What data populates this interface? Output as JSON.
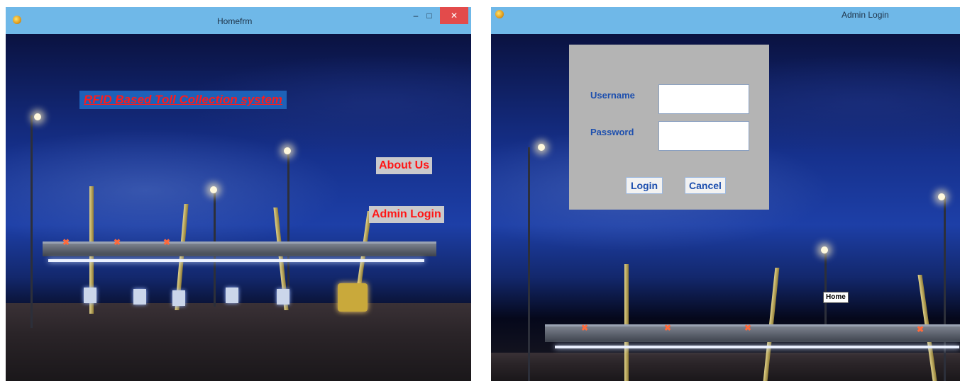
{
  "left_window": {
    "title": "Homefrm",
    "controls": {
      "minimize": "–",
      "maximize": "□",
      "close": "✕"
    },
    "heading_link": "RFID Based Toll Collection system",
    "about_us": "About Us",
    "admin_login": "Admin Login"
  },
  "right_window": {
    "title": "Admin Login",
    "dialog": {
      "username_label": "Username",
      "username_value": "",
      "password_label": "Password",
      "password_value": "",
      "login": "Login",
      "cancel": "Cancel"
    },
    "home": "Home"
  },
  "colors": {
    "titlebar": "#6fb8e8",
    "close": "#e34b4b",
    "red_text": "#ff1515",
    "label_blue": "#1d4fae",
    "dialog_bg": "#b4b4b4"
  }
}
